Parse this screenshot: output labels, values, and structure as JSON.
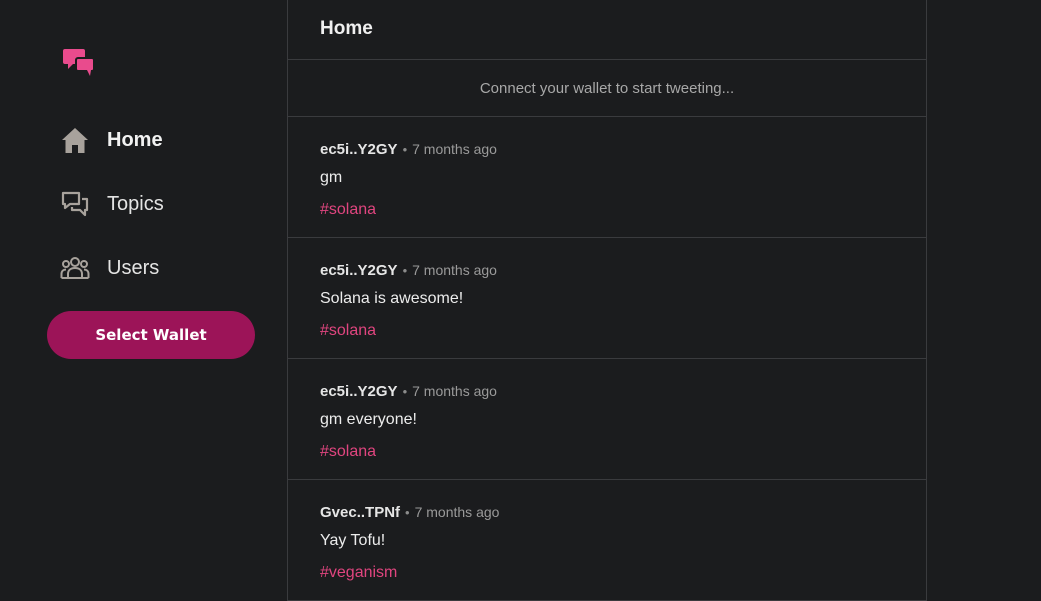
{
  "sidebar": {
    "logo_icon": "chat-bubbles-icon",
    "items": [
      {
        "label": "Home",
        "icon": "home-icon",
        "active": true
      },
      {
        "label": "Topics",
        "icon": "topics-icon",
        "active": false
      },
      {
        "label": "Users",
        "icon": "users-icon",
        "active": false
      }
    ],
    "wallet_button": "Select Wallet"
  },
  "main": {
    "title": "Home",
    "connect_prompt": "Connect your wallet to start tweeting...",
    "tweets": [
      {
        "author": "ec5i..Y2GY",
        "separator": "•",
        "time": "7 months ago",
        "content": "gm",
        "tag": "#solana"
      },
      {
        "author": "ec5i..Y2GY",
        "separator": "•",
        "time": "7 months ago",
        "content": "Solana is awesome!",
        "tag": "#solana"
      },
      {
        "author": "ec5i..Y2GY",
        "separator": "•",
        "time": "7 months ago",
        "content": "gm everyone!",
        "tag": "#solana"
      },
      {
        "author": "Gvec..TPNf",
        "separator": "•",
        "time": "7 months ago",
        "content": "Yay Tofu!",
        "tag": "#veganism"
      }
    ]
  },
  "colors": {
    "background": "#1b1c1e",
    "accent": "#9c1458",
    "logo_pink": "#e94b8d",
    "tag_pink": "#e0457f"
  }
}
